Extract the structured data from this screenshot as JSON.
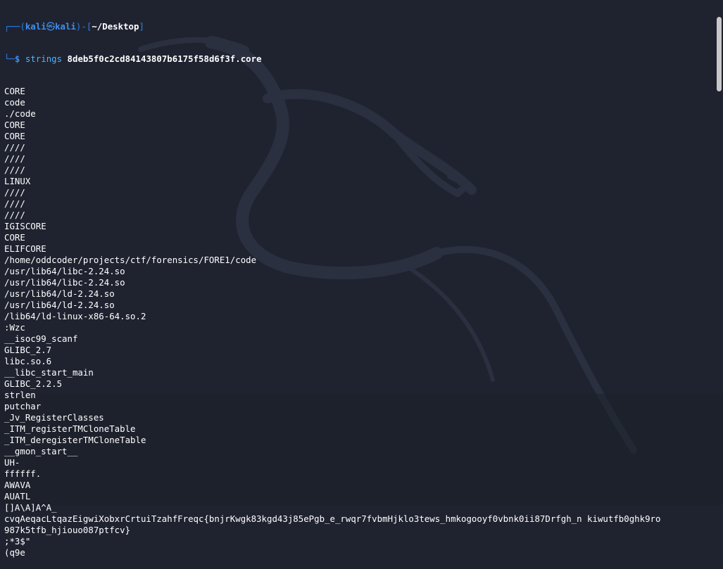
{
  "prompt": {
    "corner_top": "┌──(",
    "user": "kali",
    "at_symbol": "㉿",
    "host": "kali",
    "mid": ")-[",
    "cwd": "~/Desktop",
    "end": "]",
    "corner_bottom": "└─",
    "dollar": "$",
    "command": "strings",
    "argument": "8deb5f0c2cd84143807b6175f58d6f3f.core"
  },
  "output_lines": [
    "CORE",
    "code",
    "./code",
    "CORE",
    "CORE",
    "////",
    "////",
    "////",
    "LINUX",
    "////",
    "////",
    "////",
    "IGISCORE",
    "CORE",
    "ELIFCORE",
    "/home/oddcoder/projects/ctf/forensics/FORE1/code",
    "/usr/lib64/libc-2.24.so",
    "/usr/lib64/libc-2.24.so",
    "/usr/lib64/ld-2.24.so",
    "/usr/lib64/ld-2.24.so",
    "/lib64/ld-linux-x86-64.so.2",
    ":Wzc",
    "__isoc99_scanf",
    "GLIBC_2.7",
    "libc.so.6",
    "__libc_start_main",
    "GLIBC_2.2.5",
    "strlen",
    "putchar",
    "_Jv_RegisterClasses",
    "_ITM_registerTMCloneTable",
    "_ITM_deregisterTMCloneTable",
    "__gmon_start__",
    "UH-",
    "ffffff.",
    "AWAVA",
    "AUATL",
    "[]A\\A]A^A_",
    "cvqAeqacLtqazEigwiXobxrCrtuiTzahfFreqc{bnjrKwgk83kgd43j85ePgb_e_rwqr7fvbmHjklo3tews_hmkogooyf0vbnk0ii87Drfgh_n kiwutfb0ghk9ro",
    "987k5tfb_hjiouo087ptfcv}",
    ";*3$\"",
    "(q9e"
  ],
  "colors": {
    "background": "#1f2330",
    "prompt_blue": "#3e8ff0",
    "command_blue": "#4bb3ff",
    "text": "#ffffff"
  }
}
